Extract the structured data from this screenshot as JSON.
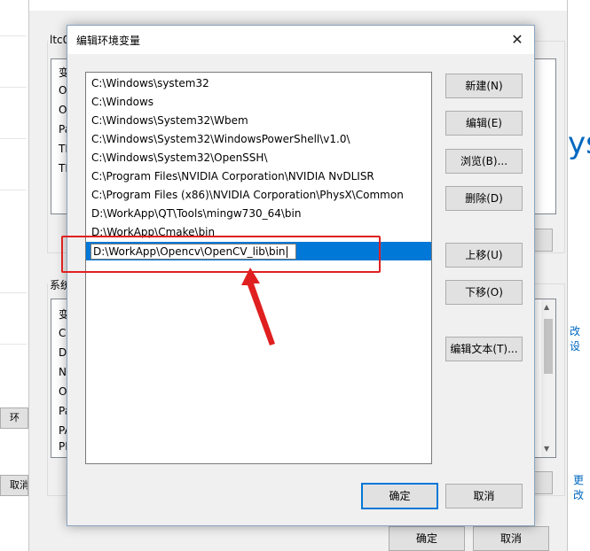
{
  "bg_window": {
    "button_fragments": [
      "环",
      "取消"
    ],
    "right_fragments": [
      "ys",
      "改设",
      "更改"
    ]
  },
  "env_window": {
    "user_group_label": "ltc01",
    "user_var_letters": [
      "变",
      "O",
      "O",
      "Pa",
      "TE",
      "TN"
    ],
    "system_group_label": "系统",
    "system_var_letters": [
      "变",
      "Co",
      "Dr",
      "N",
      "O",
      "Pa",
      "PA",
      "PR"
    ],
    "ok_button": "确定",
    "cancel_button": "取消"
  },
  "dialog": {
    "title": "编辑环境变量",
    "close_glyph": "✕",
    "paths": [
      "C:\\Windows\\system32",
      "C:\\Windows",
      "C:\\Windows\\System32\\Wbem",
      "C:\\Windows\\System32\\WindowsPowerShell\\v1.0\\",
      "C:\\Windows\\System32\\OpenSSH\\",
      "C:\\Program Files\\NVIDIA Corporation\\NVIDIA NvDLISR",
      "C:\\Program Files (x86)\\NVIDIA Corporation\\PhysX\\Common",
      "D:\\WorkApp\\QT\\Tools\\mingw730_64\\bin",
      "D:\\WorkApp\\Cmake\\bin"
    ],
    "editing_value": "D:\\WorkApp\\Opencv\\OpenCV_lib\\bin",
    "buttons": {
      "new": "新建(N)",
      "edit": "编辑(E)",
      "browse": "浏览(B)...",
      "delete": "删除(D)",
      "move_up": "上移(U)",
      "move_down": "下移(O)",
      "edit_text": "编辑文本(T)..."
    },
    "ok_button": "确定",
    "cancel_button": "取消"
  },
  "colors": {
    "selection": "#0078d7",
    "annotation": "#e02020"
  }
}
